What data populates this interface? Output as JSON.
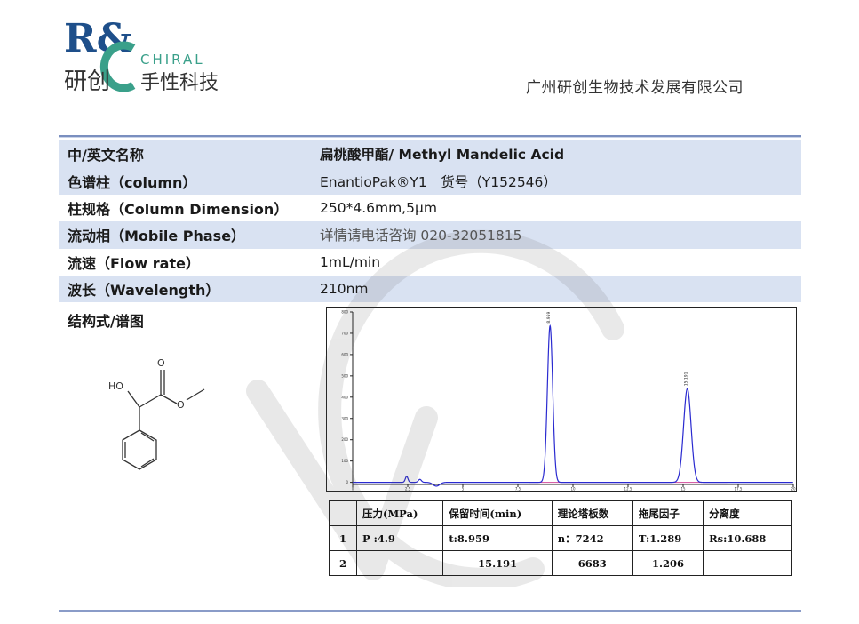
{
  "logo": {
    "letters": "R&",
    "chiral": "CHIRAL",
    "cn_left": "研创",
    "cn_right": "手性科技"
  },
  "company": "广州研创生物技术发展有限公司",
  "info_rows": [
    {
      "label": "中/英文名称",
      "value": "扁桃酸甲酯/ Methyl Mandelic Acid"
    },
    {
      "label": "色谱柱（column）",
      "value": "EnantioPak®Y1　货号（Y152546）"
    },
    {
      "label": "柱规格（Column Dimension）",
      "value": "250*4.6mm,5μm"
    },
    {
      "label": "流动相（Mobile Phase）",
      "value": "详情请电话咨询 020-32051815"
    },
    {
      "label": "流速（Flow rate）",
      "value": "1mL/min"
    },
    {
      "label": "波长（Wavelength）",
      "value": "210nm"
    }
  ],
  "structure_label": "结构式/谱图",
  "molecule": {
    "ho_label": "HO",
    "o_top": "O",
    "o_ester": "O"
  },
  "chart_data": {
    "type": "line",
    "xlim": [
      0,
      20
    ],
    "ylim": [
      -10,
      800
    ],
    "x_ticks": [
      0,
      2.5,
      5,
      7.5,
      10,
      12.5,
      15,
      17.5,
      20
    ],
    "y_ticks": [
      0,
      100,
      200,
      300,
      400,
      500,
      600,
      700,
      800
    ],
    "peaks": [
      {
        "x": 8.959,
        "height": 735,
        "sigma": 0.12,
        "label": "8.959"
      },
      {
        "x": 15.191,
        "height": 440,
        "sigma": 0.17,
        "label": "15.191"
      }
    ],
    "colors": {
      "trace": "#2a2ad0",
      "baseline": "#d04a9a",
      "axis": "#222222"
    }
  },
  "results": {
    "headers": [
      "",
      "压力(MPa)",
      "保留时间(min)",
      "理论塔板数",
      "拖尾因子",
      "分离度"
    ],
    "rows": [
      [
        "1",
        "P :4.9",
        "t:8.959",
        "n：7242",
        "T:1.289",
        "Rs:10.688"
      ],
      [
        "2",
        "",
        "15.191",
        "6683",
        "1.206",
        ""
      ]
    ]
  }
}
